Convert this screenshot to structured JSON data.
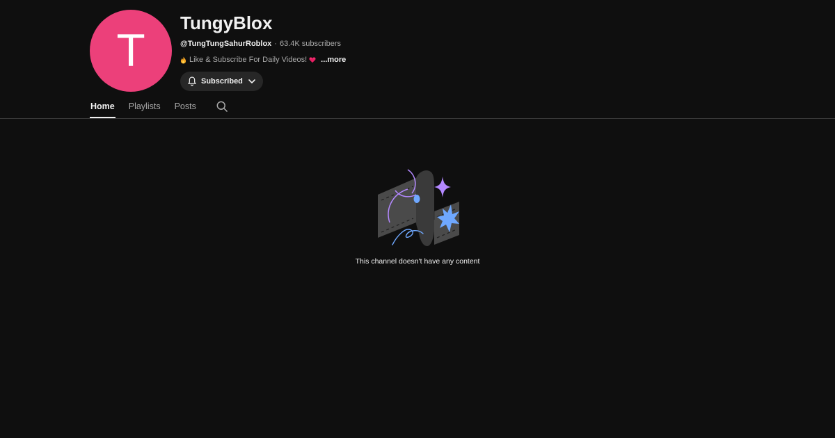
{
  "channel": {
    "avatar_letter": "T",
    "avatar_color": "#ec407a",
    "title": "TungyBlox",
    "handle": "@TungTungSahurRoblox",
    "separator": "·",
    "subscribers": "63.4K subscribers",
    "description": "Like & Subscribe For Daily Videos!",
    "description_icons": [
      "flame-icon",
      "heart-icon"
    ],
    "more_label": "...more",
    "subscribe_label": "Subscribed"
  },
  "tabs": [
    {
      "label": "Home",
      "active": true
    },
    {
      "label": "Playlists",
      "active": false
    },
    {
      "label": "Posts",
      "active": false
    }
  ],
  "empty_state": {
    "message": "This channel doesn't have any content"
  },
  "colors": {
    "background": "#0f0f0f",
    "button_bg": "#272727",
    "accent_purple": "#b388ff",
    "accent_blue": "#6fa8ff"
  }
}
